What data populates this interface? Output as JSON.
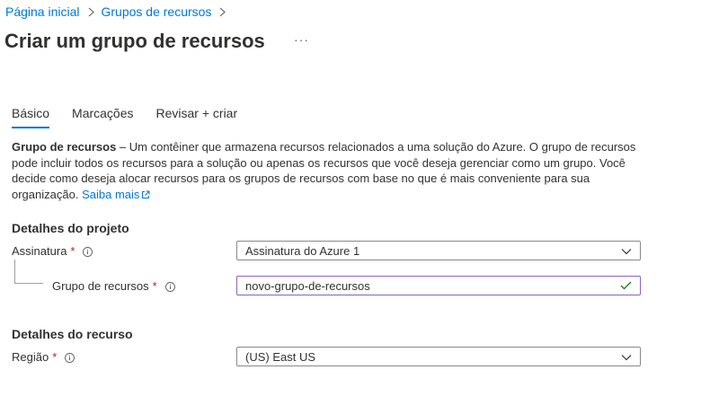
{
  "breadcrumb": {
    "home": "Página inicial",
    "groups": "Grupos de recursos"
  },
  "page": {
    "title": "Criar um grupo de recursos",
    "more": "···"
  },
  "tabs": [
    {
      "label": "Básico",
      "active": true
    },
    {
      "label": "Marcações",
      "active": false
    },
    {
      "label": "Revisar + criar",
      "active": false
    }
  ],
  "description": {
    "bold": "Grupo de recursos",
    "text": " – Um contêiner que armazena recursos relacionados a uma solução do Azure. O grupo de recursos pode incluir todos os recursos para a solução ou apenas os recursos que você deseja gerenciar como um grupo. Você decide como deseja alocar recursos para os grupos de recursos com base no que é mais conveniente para sua organização.",
    "link": "Saiba mais"
  },
  "project": {
    "heading": "Detalhes do projeto",
    "subscription": {
      "label": "Assinatura",
      "required": "*",
      "value": "Assinatura do Azure 1"
    },
    "resource_group": {
      "label": "Grupo de recursos",
      "required": "*",
      "value": "novo-grupo-de-recursos"
    }
  },
  "resource": {
    "heading": "Detalhes do recurso",
    "region": {
      "label": "Região",
      "required": "*",
      "value": "(US) East US"
    }
  },
  "colors": {
    "accent": "#0078d4",
    "required": "#a4262c",
    "valid_border": "#8764b8",
    "valid_check": "#107c10"
  }
}
